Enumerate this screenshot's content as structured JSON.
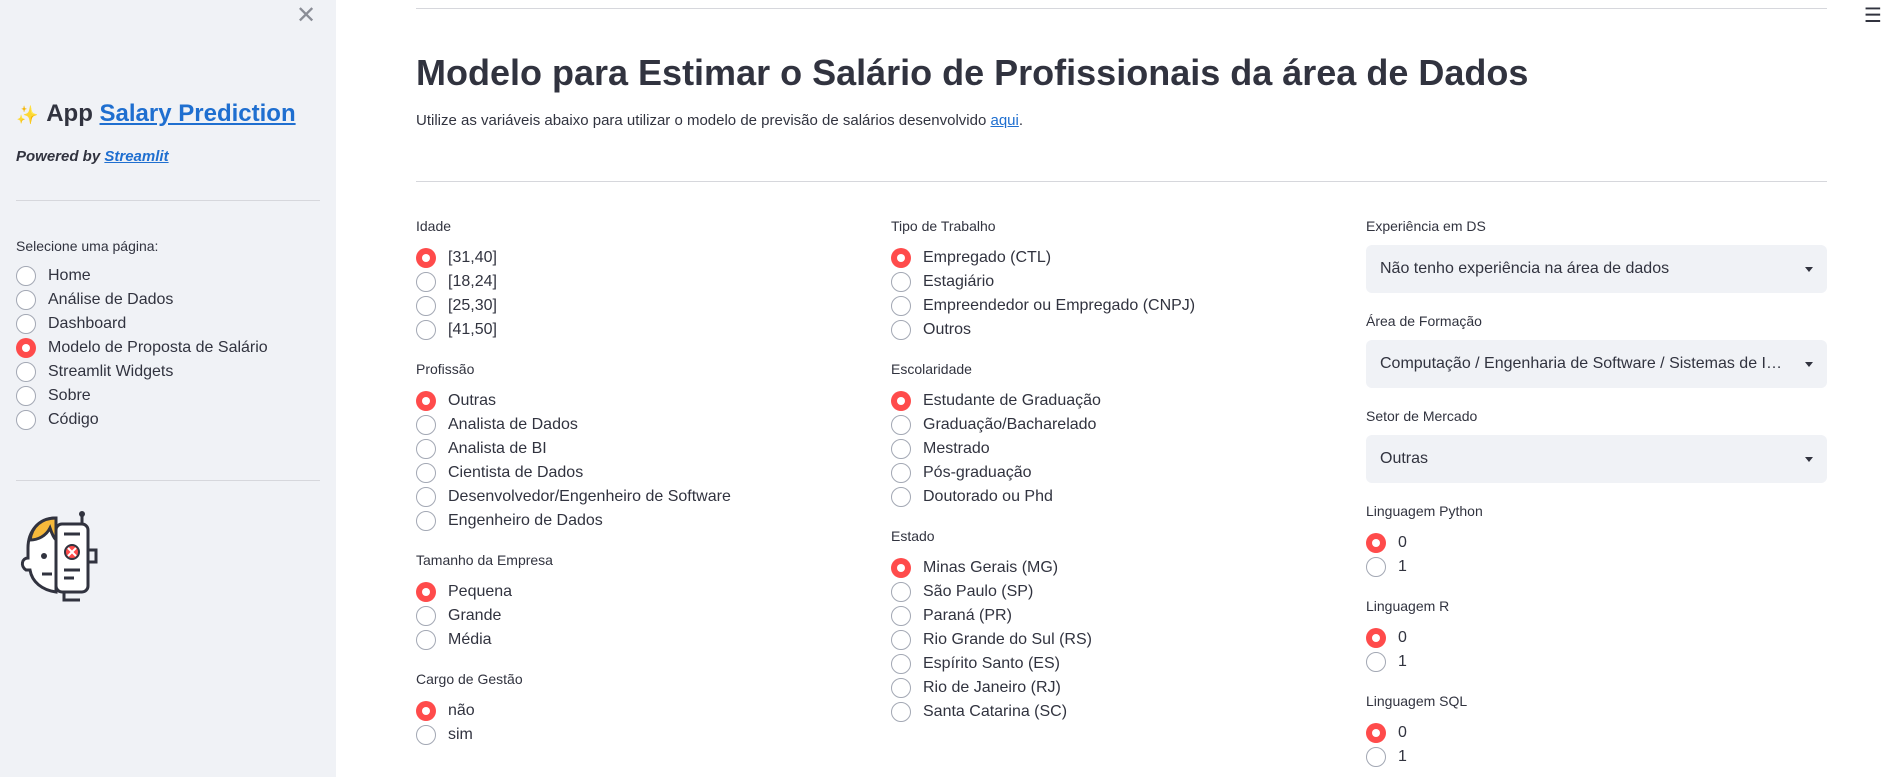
{
  "sidebar": {
    "close_glyph": "✕",
    "app_icon": "✨",
    "app_prefix": "App",
    "app_link": "Salary Prediction",
    "powered_prefix": "Powered by",
    "powered_link": "Streamlit",
    "nav_label": "Selecione uma página:",
    "nav_items": [
      "Home",
      "Análise de Dados",
      "Dashboard",
      "Modelo de Proposta de Salário",
      "Streamlit Widgets",
      "Sobre",
      "Código"
    ],
    "nav_selected_index": 3,
    "avatar_icon": "robot-human-face-icon"
  },
  "header": {
    "menu_glyph": "☰",
    "title": "Modelo para Estimar o Salário de Profissionais da área de Dados",
    "subtitle_text": "Utilize as variáveis abaixo para utilizar o modelo de previsão de salários desenvolvido",
    "subtitle_link": "aqui",
    "subtitle_end": "."
  },
  "col1": {
    "idade": {
      "label": "Idade",
      "options": [
        "[31,40]",
        "[18,24]",
        "[25,30]",
        "[41,50]"
      ],
      "selected": 0
    },
    "profissao": {
      "label": "Profissão",
      "options": [
        "Outras",
        "Analista de Dados",
        "Analista de BI",
        "Cientista de Dados",
        "Desenvolvedor/Engenheiro de Software",
        "Engenheiro de Dados"
      ],
      "selected": 0
    },
    "tamanho": {
      "label": "Tamanho da Empresa",
      "options": [
        "Pequena",
        "Grande",
        "Média"
      ],
      "selected": 0
    },
    "gestao": {
      "label": "Cargo de Gestão",
      "options": [
        "não",
        "sim"
      ],
      "selected": 0
    }
  },
  "col2": {
    "tipo": {
      "label": "Tipo de Trabalho",
      "options": [
        "Empregado (CTL)",
        "Estagiário",
        "Empreendedor ou Empregado (CNPJ)",
        "Outros"
      ],
      "selected": 0
    },
    "escolaridade": {
      "label": "Escolaridade",
      "options": [
        "Estudante de Graduação",
        "Graduação/Bacharelado",
        "Mestrado",
        "Pós-graduação",
        "Doutorado ou Phd"
      ],
      "selected": 0
    },
    "estado": {
      "label": "Estado",
      "options": [
        "Minas Gerais (MG)",
        "São Paulo (SP)",
        "Paraná (PR)",
        "Rio Grande do Sul (RS)",
        "Espírito Santo (ES)",
        "Rio de Janeiro (RJ)",
        "Santa Catarina (SC)"
      ],
      "selected": 0
    }
  },
  "col3": {
    "experiencia": {
      "label": "Experiência em DS",
      "value": "Não tenho experiência na área de dados"
    },
    "formacao": {
      "label": "Área de Formação",
      "value": "Computação / Engenharia de Software / Sistemas de Informação"
    },
    "setor": {
      "label": "Setor de Mercado",
      "value": "Outras"
    },
    "python": {
      "label": "Linguagem Python",
      "options": [
        "0",
        "1"
      ],
      "selected": 0
    },
    "r": {
      "label": "Linguagem R",
      "options": [
        "0",
        "1"
      ],
      "selected": 0
    },
    "sql": {
      "label": "Linguagem SQL",
      "options": [
        "0",
        "1"
      ],
      "selected": 0
    }
  },
  "colors": {
    "accent": "#ff4b4b",
    "link": "#1f6fd0",
    "sidebar_bg": "#f0f2f6",
    "text": "#31333f"
  }
}
